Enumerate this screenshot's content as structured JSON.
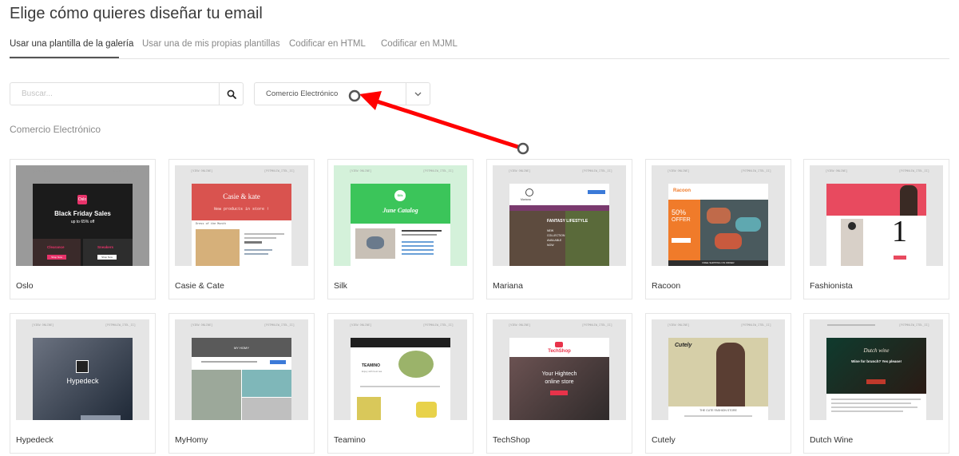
{
  "page": {
    "title": "Elige cómo quieres diseñar tu email"
  },
  "tabs": [
    {
      "label": "Usar una plantilla de la galería",
      "active": true
    },
    {
      "label": "Usar una de mis propias plantillas",
      "active": false
    },
    {
      "label": "Codificar en HTML",
      "active": false
    },
    {
      "label": "Codificar en MJML",
      "active": false
    }
  ],
  "search": {
    "placeholder": "Buscar...",
    "value": "",
    "icon": "search-icon"
  },
  "category_select": {
    "value": "Comercio Electrónico",
    "icon": "chevron-down-icon"
  },
  "section": {
    "title": "Comercio Electrónico"
  },
  "templates": [
    {
      "name": "Oslo",
      "thumb": {
        "brand": "Oslo",
        "headline": "Black Friday Sales",
        "sub": "up to 65% off",
        "left": "Clearance",
        "right": "Sneakers",
        "button": "Shop Now",
        "bg": "#1b1b1b",
        "accent": "#e8336a"
      }
    },
    {
      "name": "Casie & Cate",
      "thumb": {
        "headline": "Casie & kate",
        "sub": "New products in store !",
        "section": "Dress of the Month",
        "bg": "#d9534f"
      }
    },
    {
      "name": "Silk",
      "thumb": {
        "logo": "Silk",
        "headline": "June Catalog",
        "bg": "#3bc55a"
      }
    },
    {
      "name": "Mariana",
      "thumb": {
        "logo": "Mariana",
        "headline": "FANTASY LIFESTYLE",
        "lines": [
          "NEW",
          "COLLECTION",
          "AVAILABLE",
          "NOW"
        ],
        "accent": "#7a3a6e"
      }
    },
    {
      "name": "Racoon",
      "thumb": {
        "logo": "Racoon",
        "headline": "50%",
        "sub": "OFFER",
        "footer": "FREE SHIPPING ON ORDER",
        "accent": "#f07b2a"
      }
    },
    {
      "name": "Fashionista",
      "thumb": {
        "number": "1",
        "accent": "#e84a5f"
      }
    },
    {
      "name": "Hypedeck",
      "thumb": {
        "headline": "Hypedeck"
      }
    },
    {
      "name": "MyHomy",
      "thumb": {
        "logo": "MY HOMY"
      }
    },
    {
      "name": "Teamino",
      "thumb": {
        "logo": "TEAMINO",
        "sub": "Enjoy with best tea"
      }
    },
    {
      "name": "TechShop",
      "thumb": {
        "logo": "TechShop",
        "headline": "Your Hightech",
        "sub": "online store",
        "accent": "#e8334a"
      }
    },
    {
      "name": "Cutely",
      "thumb": {
        "logo": "Cutely",
        "sub": "THE CUTE FASHION STORE"
      }
    },
    {
      "name": "Dutch Wine",
      "thumb": {
        "logo": "Dutch wine",
        "headline": "Wine for brunch? Yes please!",
        "accent": "#c0392b"
      }
    }
  ],
  "thumb_header": {
    "left": "[VIEW ONLINE]",
    "right": "[FOTMNLIW_ITDL_II]"
  },
  "colors": {
    "annotation_arrow": "#ff0000"
  }
}
